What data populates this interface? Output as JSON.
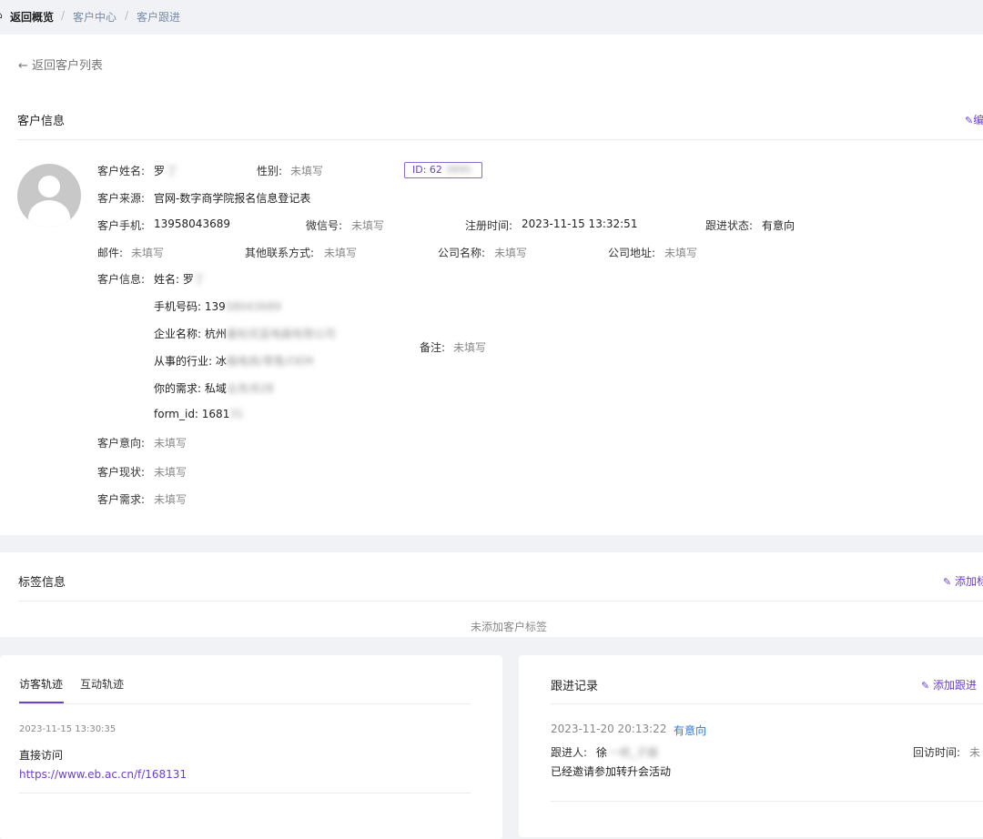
{
  "breadcrumb": {
    "home_icon": "home-icon",
    "home": "返回概览",
    "sep": "/",
    "level1": "客户中心",
    "level2": "客户跟进"
  },
  "back_link": "← 返回客户列表",
  "customer_info": {
    "title": "客户信息",
    "edit_label": "编",
    "name_label": "客户姓名:",
    "name_value": "罗",
    "name_masked": "丁",
    "gender_label": "性别:",
    "gender_value": "未填写",
    "id_value": "ID: 62",
    "id_masked": "3890",
    "source_label": "客户来源:",
    "source_value": "官网-数字商学院报名信息登记表",
    "phone_label": "客户手机:",
    "phone_value": "13958043689",
    "wechat_label": "微信号:",
    "wechat_value": "未填写",
    "reg_time_label": "注册时间:",
    "reg_time_value": "2023-11-15 13:32:51",
    "follow_status_label": "跟进状态:",
    "follow_status_value": "有意向",
    "email_label": "邮件:",
    "email_value": "未填写",
    "other_contact_label": "其他联系方式:",
    "other_contact_value": "未填写",
    "company_label": "公司名称:",
    "company_value": "未填写",
    "address_label": "公司地址:",
    "address_value": "未填写",
    "info_label": "客户信息:",
    "info_lines": [
      {
        "text": "姓名: 罗",
        "masked": "丁"
      },
      {
        "text": "手机号码: 139",
        "masked": "58043689"
      },
      {
        "text": "企业名称: 杭州",
        "masked": "曼松优蓝电器有限公司"
      },
      {
        "text": "从事的行业: 冰",
        "masked": "箱电商/零售/OEM"
      },
      {
        "text": "你的需求: 私域",
        "masked": "业务/B2B"
      },
      {
        "text": "form_id: 1681",
        "masked": "31"
      }
    ],
    "remark_label": "备注:",
    "remark_value": "未填写",
    "intent_label": "客户意向:",
    "intent_value": "未填写",
    "status_label": "客户现状:",
    "status_value": "未填写",
    "need_label": "客户需求:",
    "need_value": "未填写"
  },
  "tags": {
    "title": "标签信息",
    "add_label": "添加标",
    "empty_text": "未添加客户标签"
  },
  "visits": {
    "tab1": "访客轨迹",
    "tab2": "互动轨迹",
    "time": "2023-11-15 13:30:35",
    "type": "直接访问",
    "url": "https://www.eb.ac.cn/f/168131"
  },
  "follow": {
    "title": "跟进记录",
    "add_label": "添加跟进",
    "time": "2023-11-20 20:13:22",
    "status": "有意向",
    "person_label": "跟进人:",
    "person_value": "徐",
    "person_masked": "一帆_子器",
    "revisit_label": "回访时间:",
    "revisit_value": "未",
    "content": "已经邀请参加转升会活动"
  }
}
